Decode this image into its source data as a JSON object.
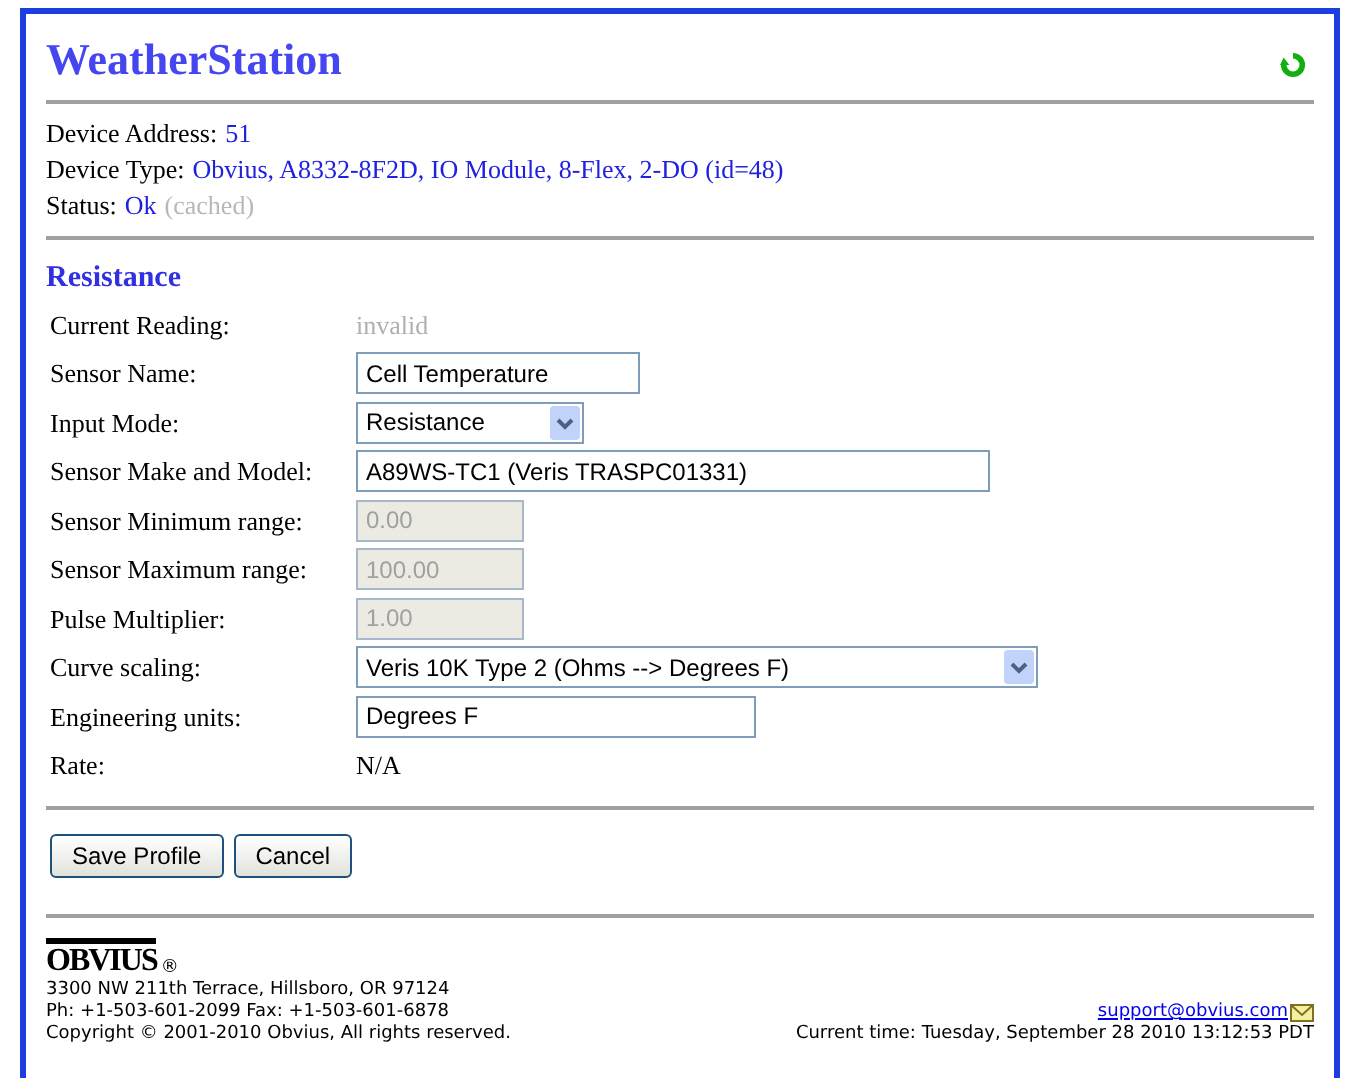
{
  "title": "WeatherStation",
  "device": [
    {
      "label": "Device Address:",
      "value": "51"
    },
    {
      "label": "Device Type:",
      "value": "Obvius, A8332-8F2D, IO Module, 8-Flex, 2-DO (id=48)"
    },
    {
      "label": "Status:",
      "value": "Ok",
      "note": "(cached)"
    }
  ],
  "section": "Resistance",
  "fields": [
    {
      "kind": "reading",
      "label": "Current Reading:",
      "value": "invalid"
    },
    {
      "kind": "input",
      "label": "Sensor Name:",
      "value": "Cell Temperature"
    },
    {
      "kind": "select",
      "label": "Input Mode:",
      "value": "Resistance"
    },
    {
      "kind": "input",
      "label": "Sensor Make and Model:",
      "value": "A89WS-TC1 (Veris TRASPC01331)"
    },
    {
      "kind": "input",
      "label": "Sensor Minimum range:",
      "value": "0.00",
      "disabled": true
    },
    {
      "kind": "input",
      "label": "Sensor Maximum range:",
      "value": "100.00",
      "disabled": true
    },
    {
      "kind": "input",
      "label": "Pulse Multiplier:",
      "value": "1.00",
      "disabled": true
    },
    {
      "kind": "select",
      "label": "Curve scaling:",
      "value": "Veris 10K Type 2 (Ohms --> Degrees F)"
    },
    {
      "kind": "input",
      "label": "Engineering units:",
      "value": "Degrees F"
    },
    {
      "kind": "text",
      "label": "Rate:",
      "value": "N/A"
    }
  ],
  "buttons": [
    "Save Profile",
    "Cancel"
  ],
  "footer": {
    "logo": "OBVIUS",
    "registered": "®",
    "address": "3300 NW 211th Terrace, Hillsboro, OR 97124",
    "phone": "Ph: +1-503-601-2099 Fax: +1-503-601-6878",
    "copyright": "Copyright © 2001-2010 Obvius, All rights reserved.",
    "email": "support@obvius.com",
    "time": "Current time: Tuesday, September 28 2010 13:12:53 PDT"
  }
}
